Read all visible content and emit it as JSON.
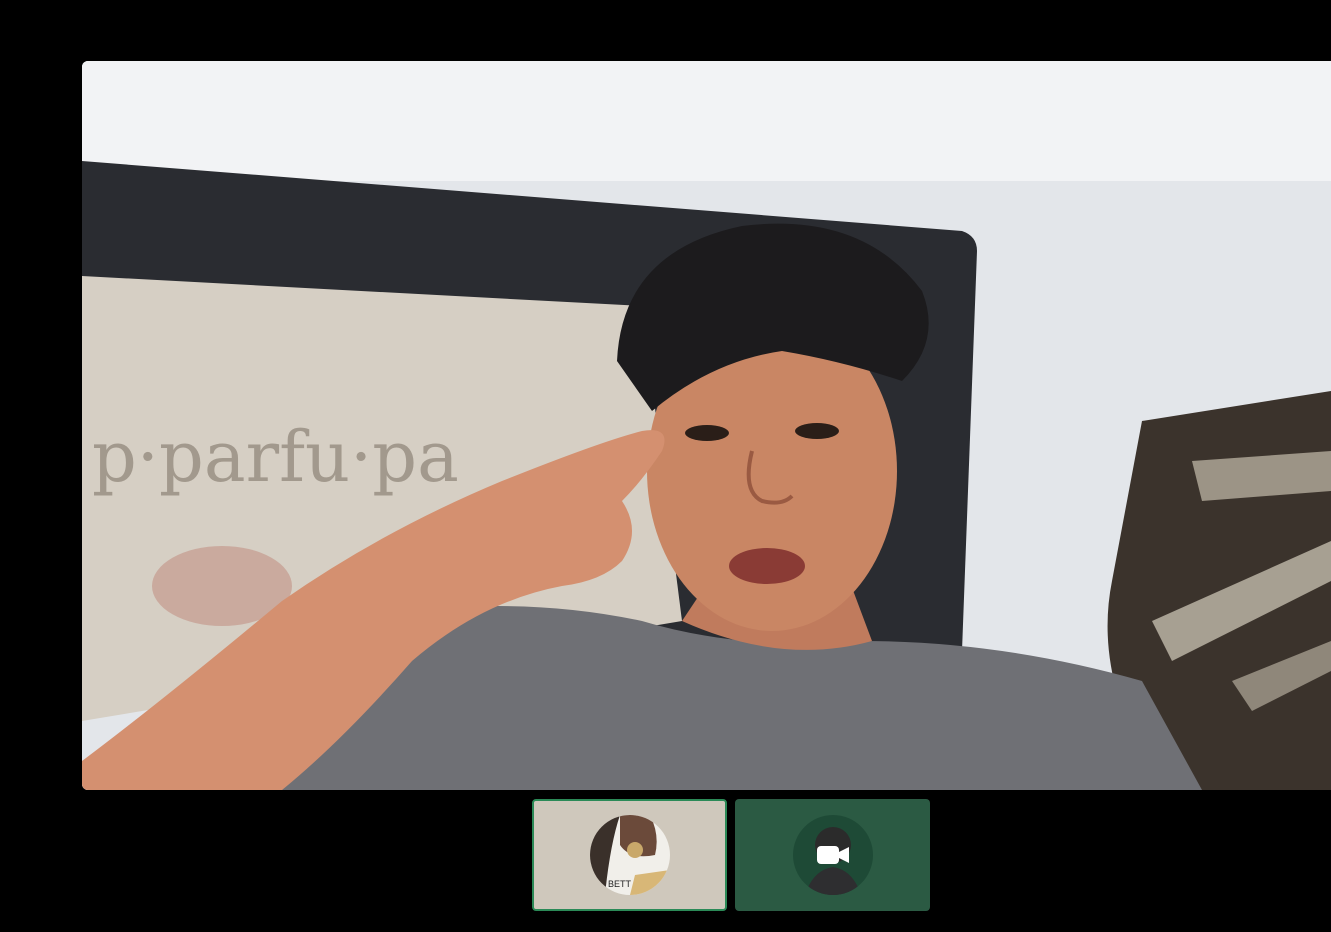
{
  "call": {
    "main_speaker_label": "",
    "participants": [
      {
        "id": "self",
        "active": true
      },
      {
        "id": "remote",
        "active": false,
        "camera_icon": "video-camera-icon"
      }
    ]
  },
  "colors": {
    "background": "#000000",
    "active_border": "#2b8a57",
    "remote_tile": "#2b5a43",
    "self_tile": "#cfc8bc"
  }
}
